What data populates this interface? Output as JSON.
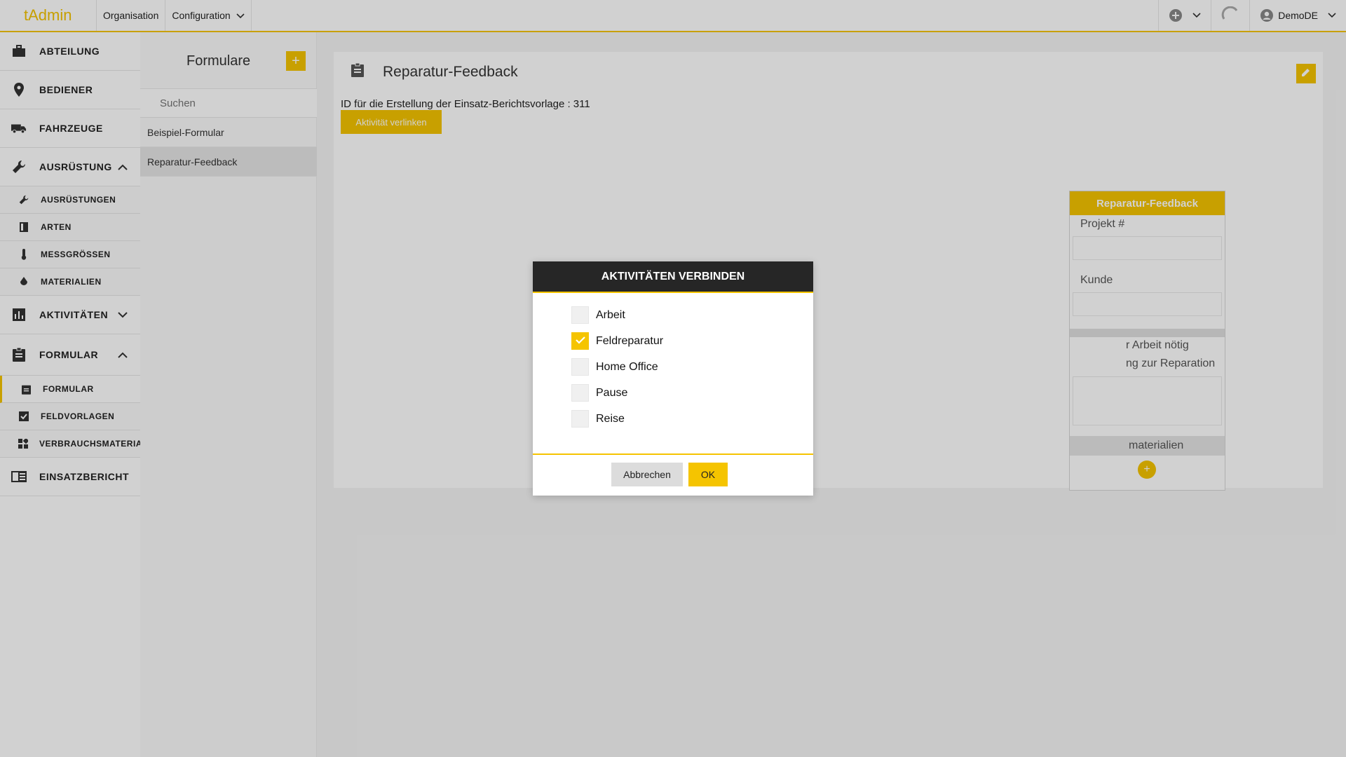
{
  "app": {
    "logo": "tAdmin",
    "accent": "#f5c400"
  },
  "topnav": {
    "organisation": "Organisation",
    "configuration": "Configuration"
  },
  "topright": {
    "user": "DemoDE"
  },
  "sidebar": {
    "items": [
      {
        "label": "ABTEILUNG",
        "icon": "briefcase-icon"
      },
      {
        "label": "BEDIENER",
        "icon": "location-pin-icon"
      },
      {
        "label": "FAHRZEUGE",
        "icon": "truck-icon"
      },
      {
        "label": "AUSRÜSTUNG",
        "icon": "wrench-icon",
        "expanded": true
      },
      {
        "label": "AUSRÜSTUNGEN",
        "icon": "wrench-icon"
      },
      {
        "label": "ARTEN",
        "icon": "book-icon"
      },
      {
        "label": "MESSGRÖSSEN",
        "icon": "thermometer-icon"
      },
      {
        "label": "MATERIALIEN",
        "icon": "drop-icon"
      },
      {
        "label": "AKTIVITÄTEN",
        "icon": "bar-chart-icon",
        "expanded": false
      },
      {
        "label": "FORMULAR",
        "icon": "clipboard-icon",
        "expanded": true
      },
      {
        "label": "FORMULAR",
        "icon": "clipboard-icon",
        "active": true
      },
      {
        "label": "FELDVORLAGEN",
        "icon": "checkbox-icon"
      },
      {
        "label": "VERBRAUCHSMATERIALIEN",
        "icon": "widgets-icon"
      },
      {
        "label": "EINSATZBERICHT",
        "icon": "report-icon"
      }
    ]
  },
  "formlist": {
    "title": "Formulare",
    "add_label": "+",
    "search_placeholder": "Suchen",
    "rows": [
      "Beispiel-Formular",
      "Reparatur-Feedback"
    ]
  },
  "detail": {
    "title": "Reparatur-Feedback",
    "id_text": "ID für die Erstellung der Einsatz-Berichtsvorlage : 311",
    "link_button": "Aktivität verlinken"
  },
  "preview": {
    "header": "Reparatur-Feedback",
    "field1": "Projekt #",
    "field2": "Kunde",
    "text1": "r Arbeit nötig",
    "text2": "ng zur Reparation",
    "section": "materialien",
    "plus": "+"
  },
  "modal": {
    "title": "AKTIVITÄTEN VERBINDEN",
    "options": [
      {
        "label": "Arbeit",
        "checked": false
      },
      {
        "label": "Feldreparatur",
        "checked": true
      },
      {
        "label": "Home Office",
        "checked": false
      },
      {
        "label": "Pause",
        "checked": false
      },
      {
        "label": "Reise",
        "checked": false
      }
    ],
    "cancel": "Abbrechen",
    "ok": "OK"
  }
}
